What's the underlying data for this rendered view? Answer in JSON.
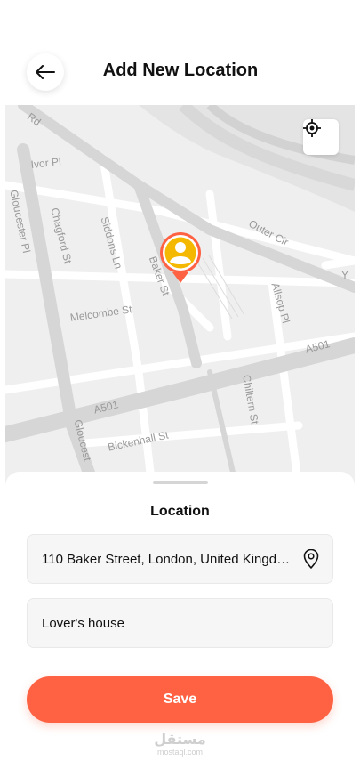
{
  "header": {
    "title": "Add New Location"
  },
  "map": {
    "streets": {
      "rd": "Rd",
      "ivor": "Ivor Pl",
      "gloucester_pl": "Gloucester Pl",
      "chagford": "Chagford St",
      "siddons": "Siddons Ln",
      "baker": "Baker St",
      "outer": "Outer Cir",
      "melcombe": "Melcombe St",
      "allsop": "Allsop Pl",
      "a501_right": "A501",
      "a501_left": "A501",
      "chiltern": "Chiltern St",
      "gloucester_lower": "Gloucest",
      "bickenhall": "Bickenhall St",
      "y_partial": "Y"
    }
  },
  "sheet": {
    "title": "Location",
    "address_value": "110 Baker Street, London, United Kingdom",
    "name_value": "Lover's house",
    "save_label": "Save"
  },
  "watermark": {
    "main": "مستقل",
    "sub": "mostaql.com"
  },
  "colors": {
    "accent": "#ff6243",
    "pin_fill": "#f5b800",
    "pin_ring": "#ff6243"
  }
}
